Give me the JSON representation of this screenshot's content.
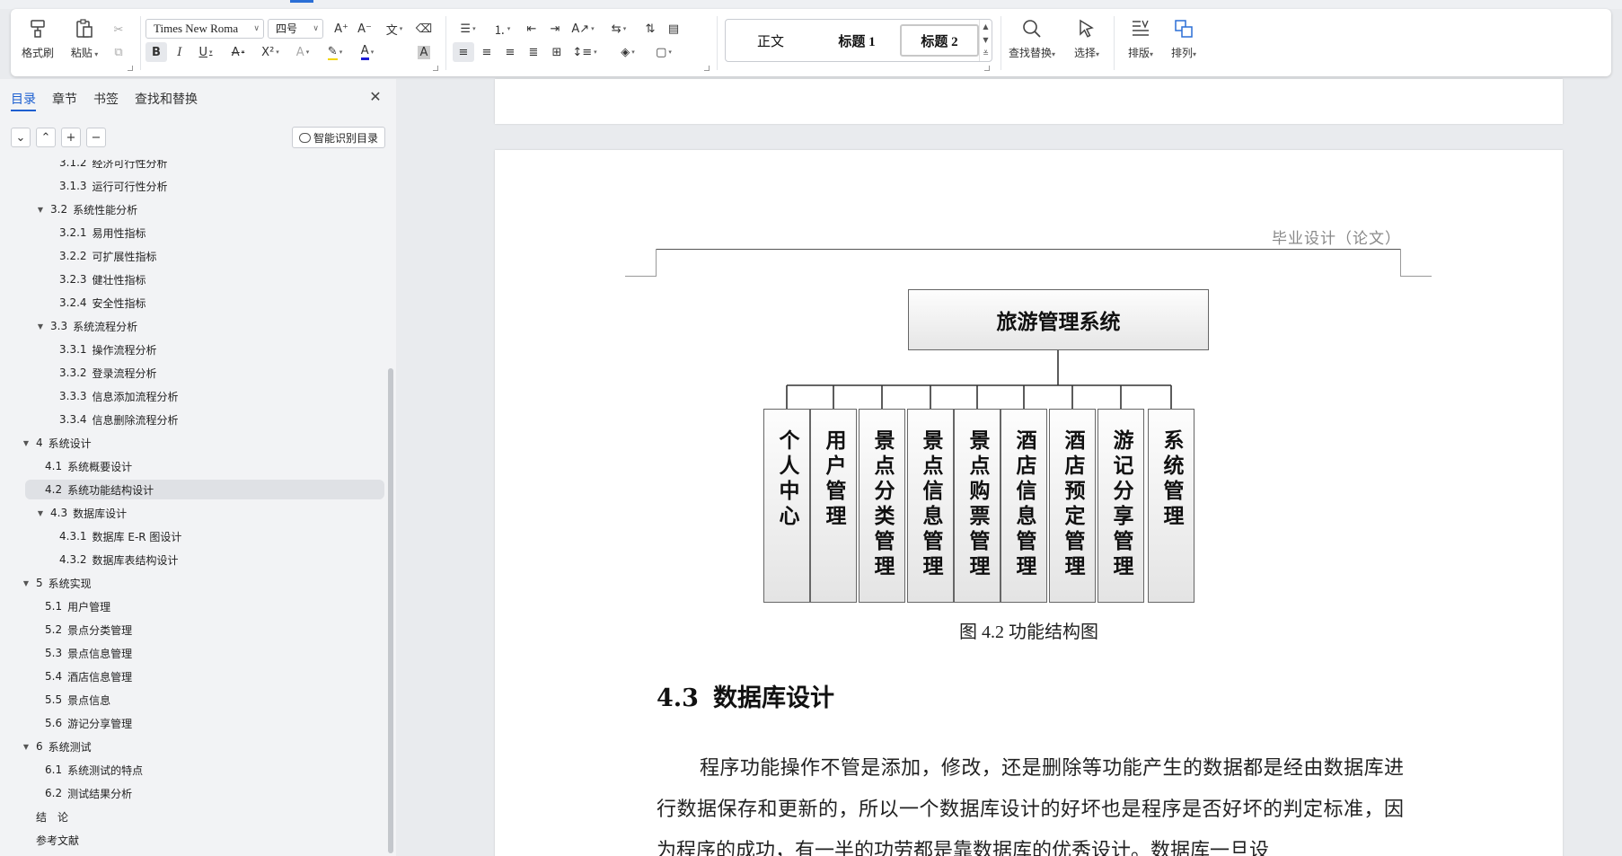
{
  "ribbon": {
    "format_painter": "格式刷",
    "paste": "粘贴",
    "font_name": "Times New Roma",
    "font_size": "四号",
    "styles": [
      "正文",
      "标题 1",
      "标题 2"
    ],
    "find_replace": "查找替换",
    "select": "选择",
    "layout": "排版",
    "arrange": "排列"
  },
  "nav": {
    "tabs": [
      "目录",
      "章节",
      "书签",
      "查找和替换"
    ],
    "smart_toc": "智能识别目录",
    "toc": [
      {
        "num": "3.1.2",
        "text": "经济可行性分析",
        "level": 3
      },
      {
        "num": "3.1.3",
        "text": "运行可行性分析",
        "level": 3
      },
      {
        "num": "3.2",
        "text": "系统性能分析",
        "level": 2,
        "expand": true
      },
      {
        "num": "3.2.1",
        "text": "易用性指标",
        "level": 3
      },
      {
        "num": "3.2.2",
        "text": "可扩展性指标",
        "level": 3
      },
      {
        "num": "3.2.3",
        "text": "健壮性指标",
        "level": 3
      },
      {
        "num": "3.2.4",
        "text": "安全性指标",
        "level": 3
      },
      {
        "num": "3.3",
        "text": "系统流程分析",
        "level": 2,
        "expand": true
      },
      {
        "num": "3.3.1",
        "text": "操作流程分析",
        "level": 3
      },
      {
        "num": "3.3.2",
        "text": "登录流程分析",
        "level": 3
      },
      {
        "num": "3.3.3",
        "text": "信息添加流程分析",
        "level": 3
      },
      {
        "num": "3.3.4",
        "text": "信息删除流程分析",
        "level": 3
      },
      {
        "num": "4",
        "text": "系统设计",
        "level": 1,
        "expand": true
      },
      {
        "num": "4.1",
        "text": "系统概要设计",
        "level": 2
      },
      {
        "num": "4.2",
        "text": "系统功能结构设计",
        "level": 2,
        "selected": true
      },
      {
        "num": "4.3",
        "text": "数据库设计",
        "level": 2,
        "expand": true
      },
      {
        "num": "4.3.1",
        "text": "数据库 E-R 图设计",
        "level": 3
      },
      {
        "num": "4.3.2",
        "text": "数据库表结构设计",
        "level": 3
      },
      {
        "num": "5",
        "text": "系统实现",
        "level": 1,
        "expand": true
      },
      {
        "num": "5.1",
        "text": "用户管理",
        "level": 2
      },
      {
        "num": "5.2",
        "text": "景点分类管理",
        "level": 2
      },
      {
        "num": "5.3",
        "text": "景点信息管理",
        "level": 2
      },
      {
        "num": "5.4",
        "text": "酒店信息管理",
        "level": 2
      },
      {
        "num": "5.5",
        "text": "景点信息",
        "level": 2
      },
      {
        "num": "5.6",
        "text": "游记分享管理",
        "level": 2
      },
      {
        "num": "6",
        "text": "系统测试",
        "level": 1,
        "expand": true
      },
      {
        "num": "6.1",
        "text": "系统测试的特点",
        "level": 2
      },
      {
        "num": "6.2",
        "text": "测试结果分析",
        "level": 2
      },
      {
        "num": "",
        "text": "结　论",
        "level": 1
      },
      {
        "num": "",
        "text": "参考文献",
        "level": 1
      }
    ]
  },
  "doc": {
    "header": "毕业设计（论文）",
    "diagram_root": "旅游管理系统",
    "diagram_children": [
      "个人中心",
      "用户管理",
      "景点分类管理",
      "景点信息管理",
      "景点购票管理",
      "酒店信息管理",
      "酒店预定管理",
      "游记分享管理",
      "系统管理"
    ],
    "caption": "图 4.2  功能结构图",
    "heading_num": "4.3",
    "heading_text": "数据库设计",
    "paragraph": "程序功能操作不管是添加，修改，还是删除等功能产生的数据都是经由数据库进行数据保存和更新的，所以一个数据库设计的好坏也是程序是否好坏的判定标准，因为程序的成功，有一半的功劳都是靠数据库的优秀设计。数据库一旦设"
  }
}
